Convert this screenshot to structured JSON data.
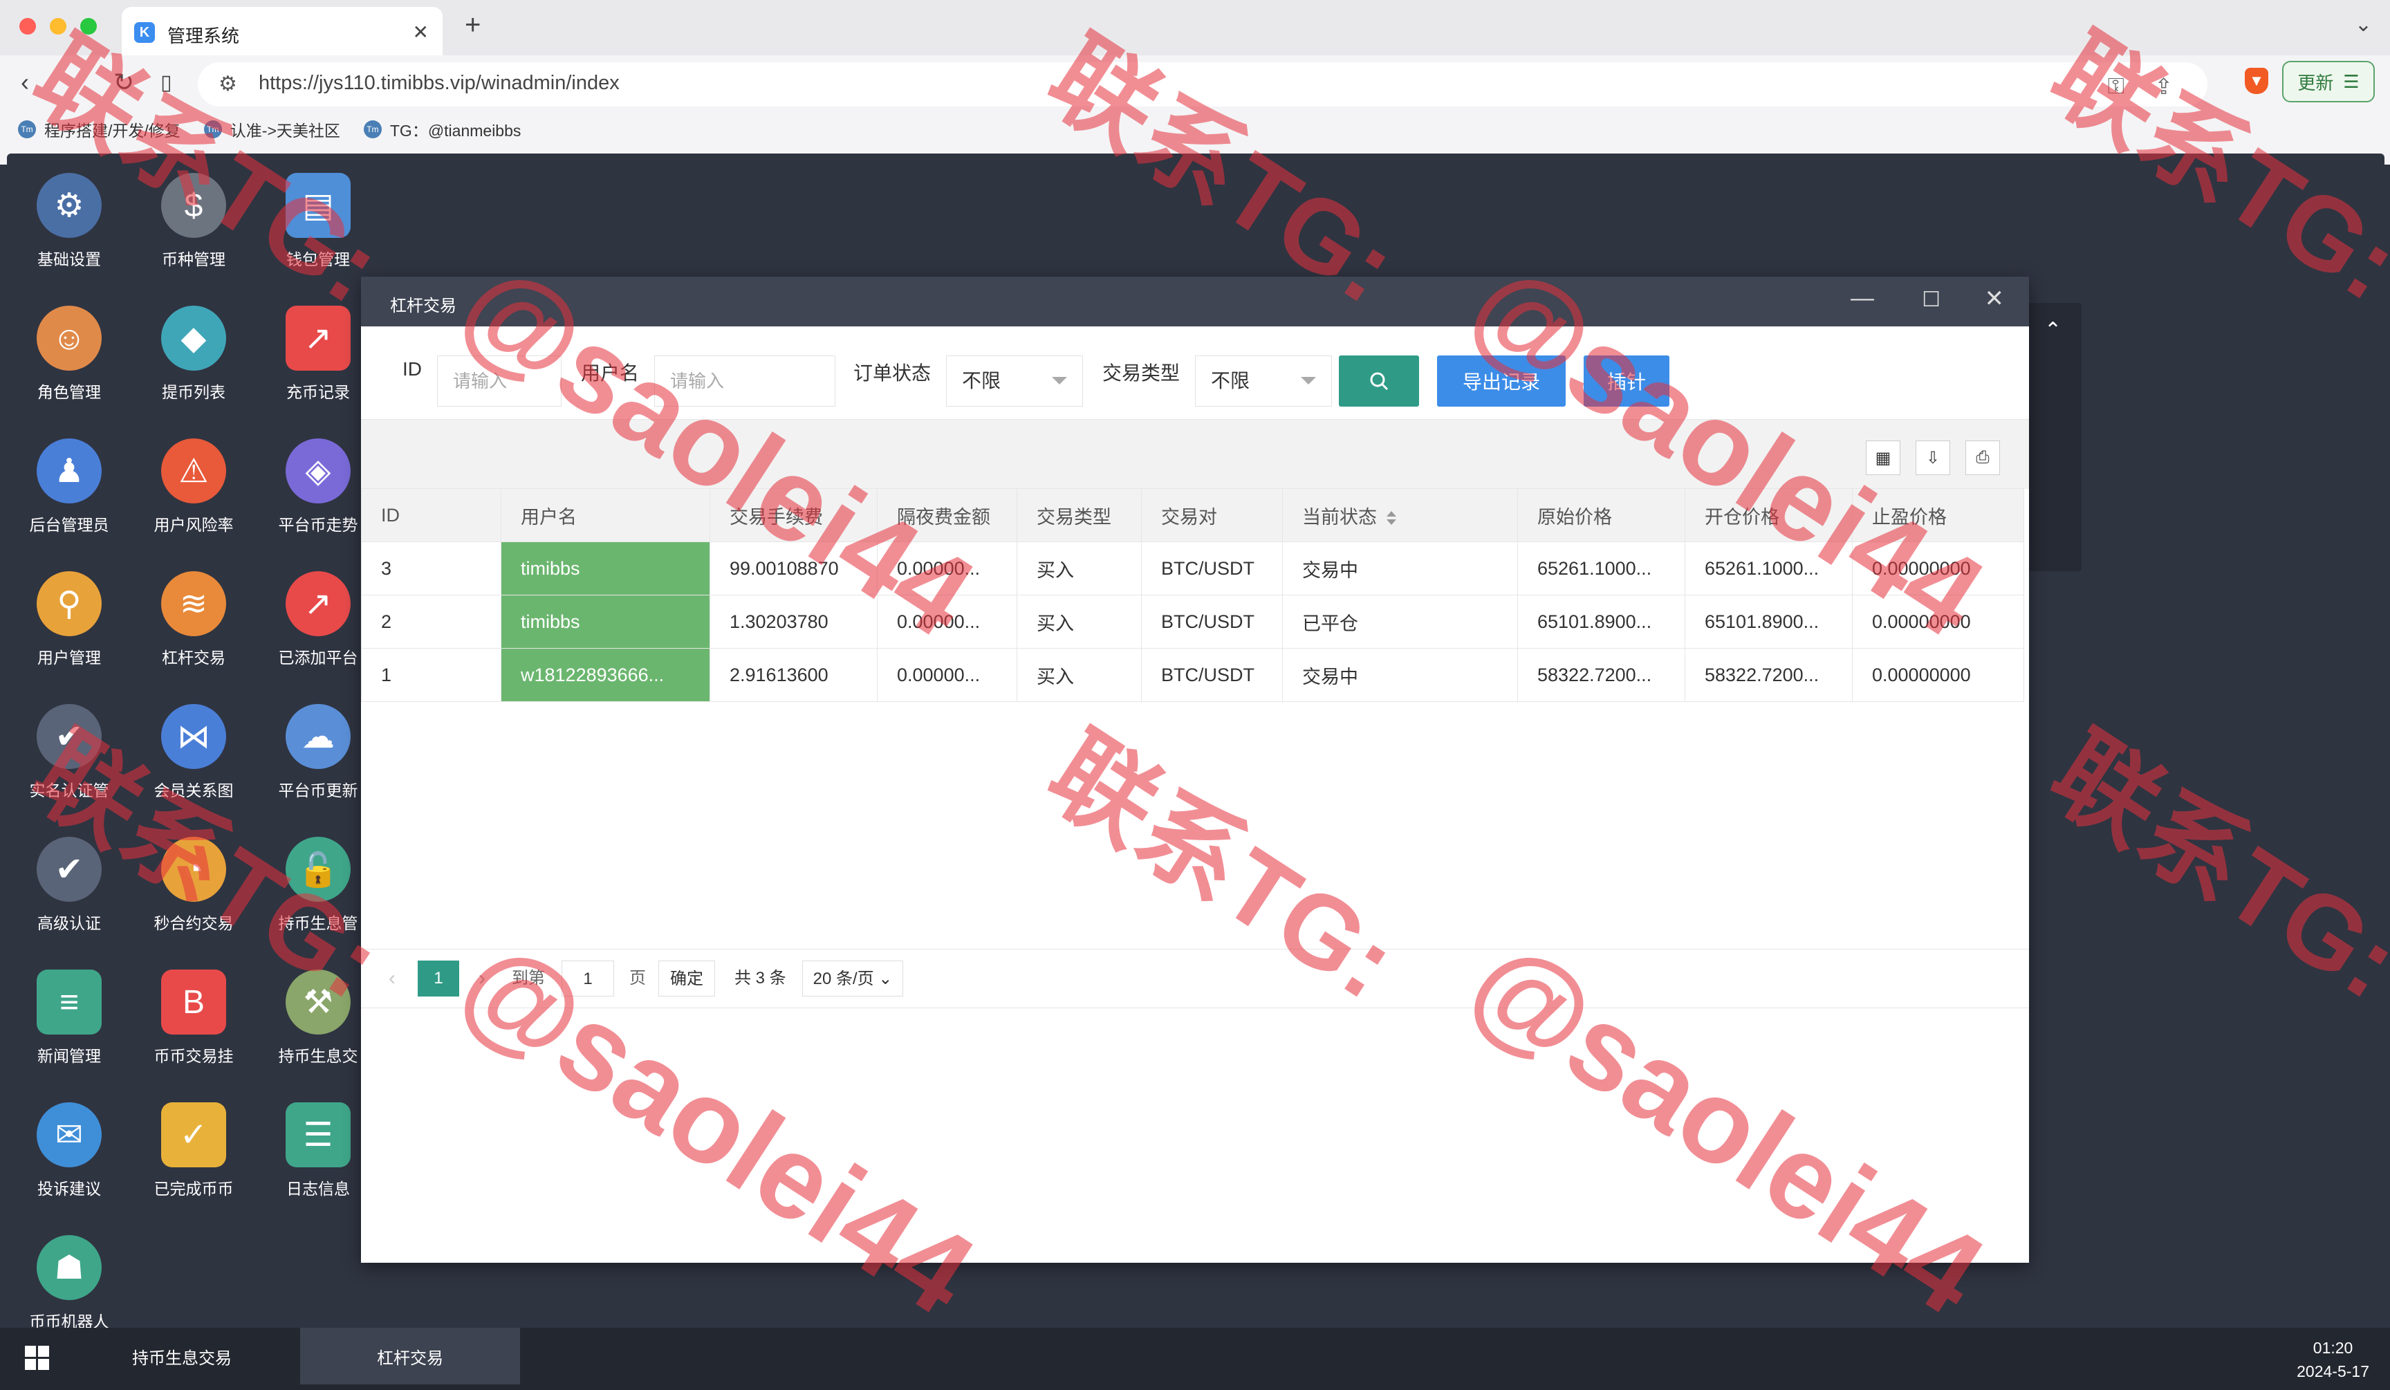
{
  "browser": {
    "tab_title": "管理系统",
    "tab_favicon": "K",
    "url": "https://jys110.timibbs.vip/winadmin/index",
    "update_label": "更新",
    "bookmarks": [
      {
        "label": "程序搭建/开发/修复"
      },
      {
        "label": "认准->天美社区"
      },
      {
        "label": "TG：@tianmeibbs"
      }
    ]
  },
  "desktop": {
    "icons": [
      {
        "label": "基础设置",
        "icon": "gear-icon",
        "color": "#4a6fa5"
      },
      {
        "label": "币种管理",
        "icon": "dollar-icon",
        "color": "#6c7480"
      },
      {
        "label": "钱包管理",
        "icon": "wallet-icon",
        "color": "#4f8fd8"
      },
      {
        "label": "角色管理",
        "icon": "roles-icon",
        "color": "#e08a4a"
      },
      {
        "label": "提币列表",
        "icon": "withdraw-icon",
        "color": "#3fa6b8"
      },
      {
        "label": "充币记录",
        "icon": "deposit-chart-icon",
        "color": "#e84a4a"
      },
      {
        "label": "后台管理员",
        "icon": "admin-user-icon",
        "color": "#4a7fd8"
      },
      {
        "label": "用户风险率",
        "icon": "alarm-icon",
        "color": "#e85a3a"
      },
      {
        "label": "平台币走势",
        "icon": "layers-icon",
        "color": "#7a6ad8"
      },
      {
        "label": "用户管理",
        "icon": "user-search-icon",
        "color": "#e8a23a"
      },
      {
        "label": "杠杆交易",
        "icon": "stack-icon",
        "color": "#e88a3a"
      },
      {
        "label": "已添加平台",
        "icon": "trend-icon",
        "color": "#e84a4a"
      },
      {
        "label": "实名认证管",
        "icon": "verify-icon",
        "color": "#5a6478"
      },
      {
        "label": "会员关系图",
        "icon": "network-icon",
        "color": "#4a7fd8"
      },
      {
        "label": "平台币更新",
        "icon": "cloud-refresh-icon",
        "color": "#5a8fd8"
      },
      {
        "label": "高级认证",
        "icon": "advanced-verify-icon",
        "color": "#5a6478"
      },
      {
        "label": "秒合约交易",
        "icon": "stopwatch-icon",
        "color": "#e8a23a"
      },
      {
        "label": "持币生息管",
        "icon": "lock-icon",
        "color": "#3fa68a"
      },
      {
        "label": "新闻管理",
        "icon": "news-icon",
        "color": "#3fa68a"
      },
      {
        "label": "币币交易挂",
        "icon": "bitcoin-icon",
        "color": "#e84a4a"
      },
      {
        "label": "持币生息交",
        "icon": "hammer-icon",
        "color": "#8aa66a"
      },
      {
        "label": "投诉建议",
        "icon": "mail-icon",
        "color": "#3f8fd8"
      },
      {
        "label": "已完成币币",
        "icon": "check-doc-icon",
        "color": "#e8b23a"
      },
      {
        "label": "日志信息",
        "icon": "log-icon",
        "color": "#3fa68a"
      },
      {
        "label": "币币机器人",
        "icon": "robot-icon",
        "color": "#3fa68a"
      }
    ]
  },
  "window": {
    "title": "杠杆交易",
    "filters": {
      "id_label": "ID",
      "id_placeholder": "请输入",
      "username_label": "用户名",
      "username_placeholder": "请输入",
      "order_status_label": "订单状态",
      "order_status_value": "不限",
      "trade_type_label": "交易类型",
      "trade_type_value": "不限",
      "export_label": "导出记录",
      "pin_label": "插针"
    },
    "table": {
      "columns": [
        "ID",
        "用户名",
        "交易手续费",
        "隔夜费金额",
        "交易类型",
        "交易对",
        "当前状态",
        "原始价格",
        "开仓价格",
        "止盈价格"
      ],
      "rows": [
        {
          "id": "3",
          "username": "timibbs",
          "fee": "99.00108870",
          "overnight": "0.00000...",
          "type": "买入",
          "pair": "BTC/USDT",
          "status": "交易中",
          "orig_price": "65261.1000...",
          "open_price": "65261.1000...",
          "tp_price": "0.00000000"
        },
        {
          "id": "2",
          "username": "timibbs",
          "fee": "1.30203780",
          "overnight": "0.00000...",
          "type": "买入",
          "pair": "BTC/USDT",
          "status": "已平仓",
          "orig_price": "65101.8900...",
          "open_price": "65101.8900...",
          "tp_price": "0.00000000"
        },
        {
          "id": "1",
          "username": "w18122893666...",
          "fee": "2.91613600",
          "overnight": "0.00000...",
          "type": "买入",
          "pair": "BTC/USDT",
          "status": "交易中",
          "orig_price": "58322.7200...",
          "open_price": "58322.7200...",
          "tp_price": "0.00000000"
        }
      ]
    },
    "pager": {
      "current_page": "1",
      "goto_label": "到第",
      "goto_value": "1",
      "page_suffix": "页",
      "confirm_label": "确定",
      "total_label": "共 3 条",
      "page_size": "20 条/页"
    }
  },
  "taskbar": {
    "tasks": [
      {
        "label": "持币生息交易"
      },
      {
        "label": "杠杆交易"
      }
    ],
    "time": "01:20",
    "date": "2024-5-17"
  },
  "watermark": {
    "contact_text": "联系TG:",
    "handle_text": "@saolei44",
    "color": "#e6323c"
  },
  "colors": {
    "desktop_bg": "#2f3441",
    "search_btn": "#2f9b87",
    "primary_btn": "#3c8de8",
    "active_page": "#2f9b87",
    "username_cell": "#6bb66f"
  }
}
